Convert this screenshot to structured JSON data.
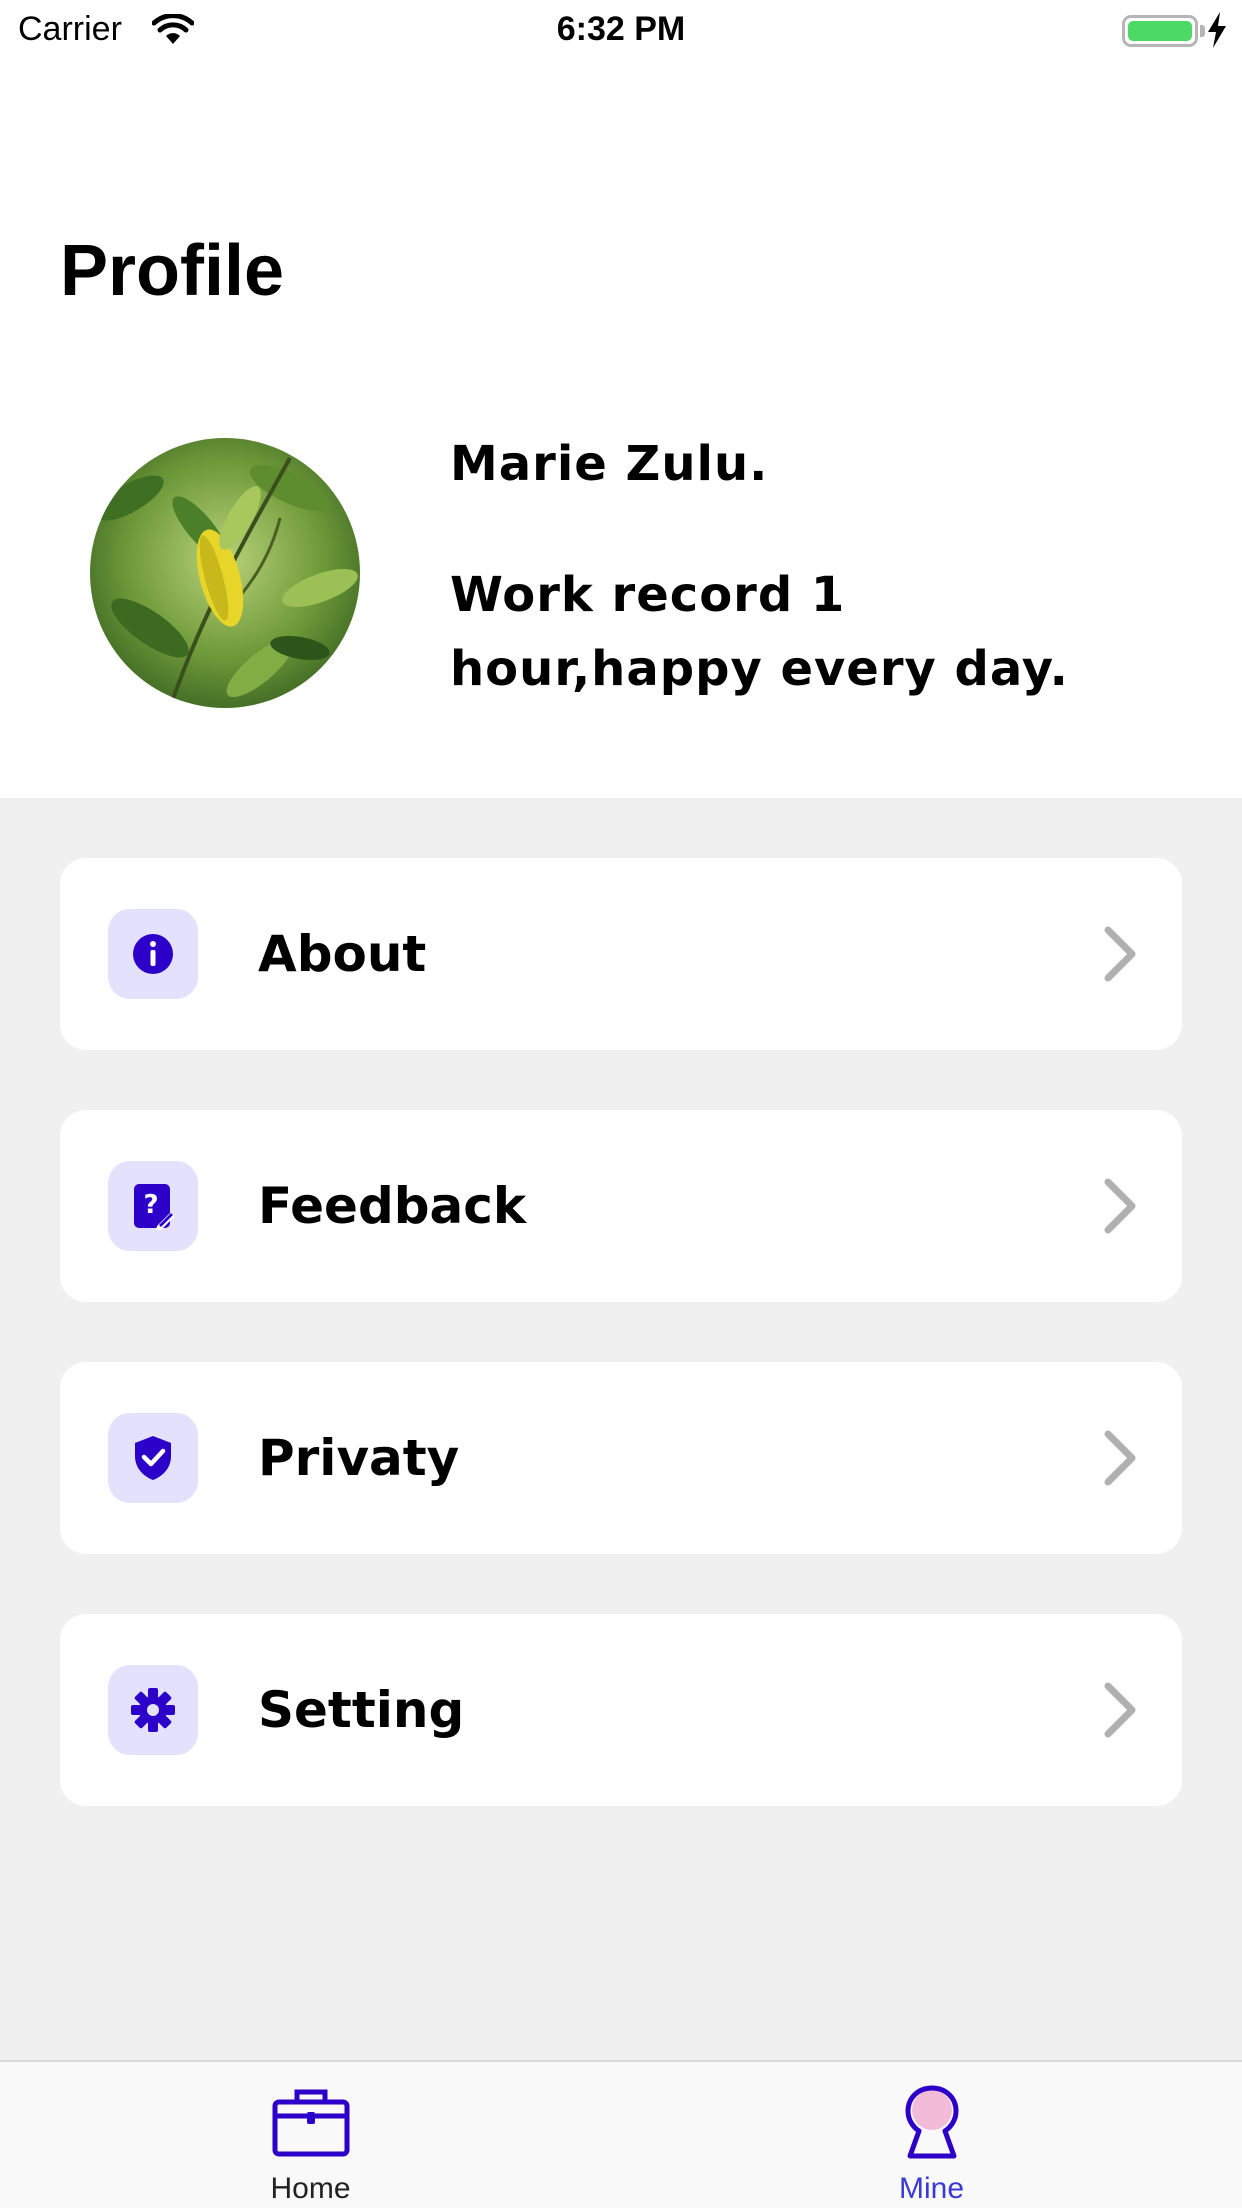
{
  "status_bar": {
    "carrier": "Carrier",
    "time": "6:32 PM",
    "battery_level": 1.0
  },
  "header": {
    "title": "Profile"
  },
  "profile": {
    "name": "Marie Zulu.",
    "bio": "Work record 1 hour,happy every day."
  },
  "menu": {
    "items": [
      {
        "label": "About",
        "icon": "info-icon"
      },
      {
        "label": "Feedback",
        "icon": "question-edit-icon"
      },
      {
        "label": "Privaty",
        "icon": "shield-check-icon"
      },
      {
        "label": "Setting",
        "icon": "gear-icon"
      }
    ]
  },
  "tab_bar": {
    "tabs": [
      {
        "label": "Home",
        "icon": "briefcase-icon",
        "active": false
      },
      {
        "label": "Mine",
        "icon": "person-icon",
        "active": true
      }
    ]
  },
  "colors": {
    "accent": "#2c00c8",
    "icon_background": "#e4e1fd",
    "active_tab": "#3a3ad6",
    "menu_background": "#f0f0f0",
    "chevron": "#b0b0b0"
  }
}
